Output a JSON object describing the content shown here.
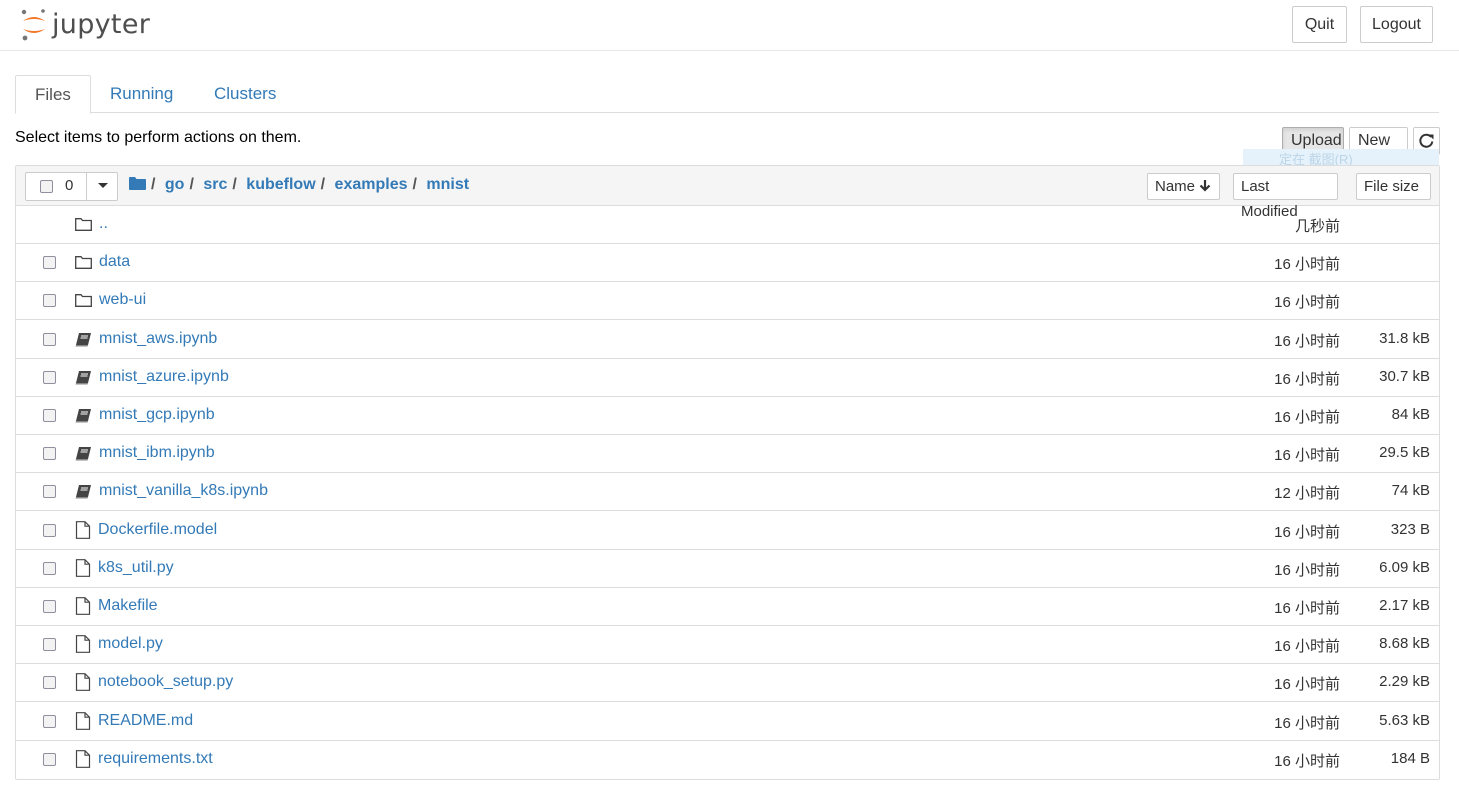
{
  "header": {
    "brand": "jupyter",
    "quit_label": "Quit",
    "logout_label": "Logout"
  },
  "tabs": [
    {
      "label": "Files",
      "active": true
    },
    {
      "label": "Running",
      "active": false
    },
    {
      "label": "Clusters",
      "active": false
    }
  ],
  "toolbar": {
    "hint": "Select items to perform actions on them.",
    "upload_label": "Upload",
    "new_label": "New",
    "selected_count": "0",
    "ghost_text": "定在 截图(R)"
  },
  "breadcrumbs": [
    {
      "label": "/",
      "root": true
    },
    {
      "label": "go"
    },
    {
      "label": "src"
    },
    {
      "label": "kubeflow"
    },
    {
      "label": "examples"
    },
    {
      "label": "mnist"
    }
  ],
  "sort": {
    "name_label": "Name",
    "modified_label": "Last Modified",
    "size_label": "File size"
  },
  "files": [
    {
      "name": "..",
      "type": "folder",
      "modified": "几秒前",
      "size": "",
      "checkbox": false
    },
    {
      "name": "data",
      "type": "folder",
      "modified": "16 小时前",
      "size": "",
      "checkbox": true
    },
    {
      "name": "web-ui",
      "type": "folder",
      "modified": "16 小时前",
      "size": "",
      "checkbox": true
    },
    {
      "name": "mnist_aws.ipynb",
      "type": "notebook",
      "modified": "16 小时前",
      "size": "31.8 kB",
      "checkbox": true
    },
    {
      "name": "mnist_azure.ipynb",
      "type": "notebook",
      "modified": "16 小时前",
      "size": "30.7 kB",
      "checkbox": true
    },
    {
      "name": "mnist_gcp.ipynb",
      "type": "notebook",
      "modified": "16 小时前",
      "size": "84 kB",
      "checkbox": true
    },
    {
      "name": "mnist_ibm.ipynb",
      "type": "notebook",
      "modified": "16 小时前",
      "size": "29.5 kB",
      "checkbox": true
    },
    {
      "name": "mnist_vanilla_k8s.ipynb",
      "type": "notebook",
      "modified": "12 小时前",
      "size": "74 kB",
      "checkbox": true
    },
    {
      "name": "Dockerfile.model",
      "type": "file",
      "modified": "16 小时前",
      "size": "323 B",
      "checkbox": true
    },
    {
      "name": "k8s_util.py",
      "type": "file",
      "modified": "16 小时前",
      "size": "6.09 kB",
      "checkbox": true
    },
    {
      "name": "Makefile",
      "type": "file",
      "modified": "16 小时前",
      "size": "2.17 kB",
      "checkbox": true
    },
    {
      "name": "model.py",
      "type": "file",
      "modified": "16 小时前",
      "size": "8.68 kB",
      "checkbox": true
    },
    {
      "name": "notebook_setup.py",
      "type": "file",
      "modified": "16 小时前",
      "size": "2.29 kB",
      "checkbox": true
    },
    {
      "name": "README.md",
      "type": "file",
      "modified": "16 小时前",
      "size": "5.63 kB",
      "checkbox": true
    },
    {
      "name": "requirements.txt",
      "type": "file",
      "modified": "16 小时前",
      "size": "184 B",
      "checkbox": true
    }
  ],
  "colors": {
    "link": "#337ab7",
    "brand_orange": "#f37726",
    "brand_gray": "#767677"
  }
}
